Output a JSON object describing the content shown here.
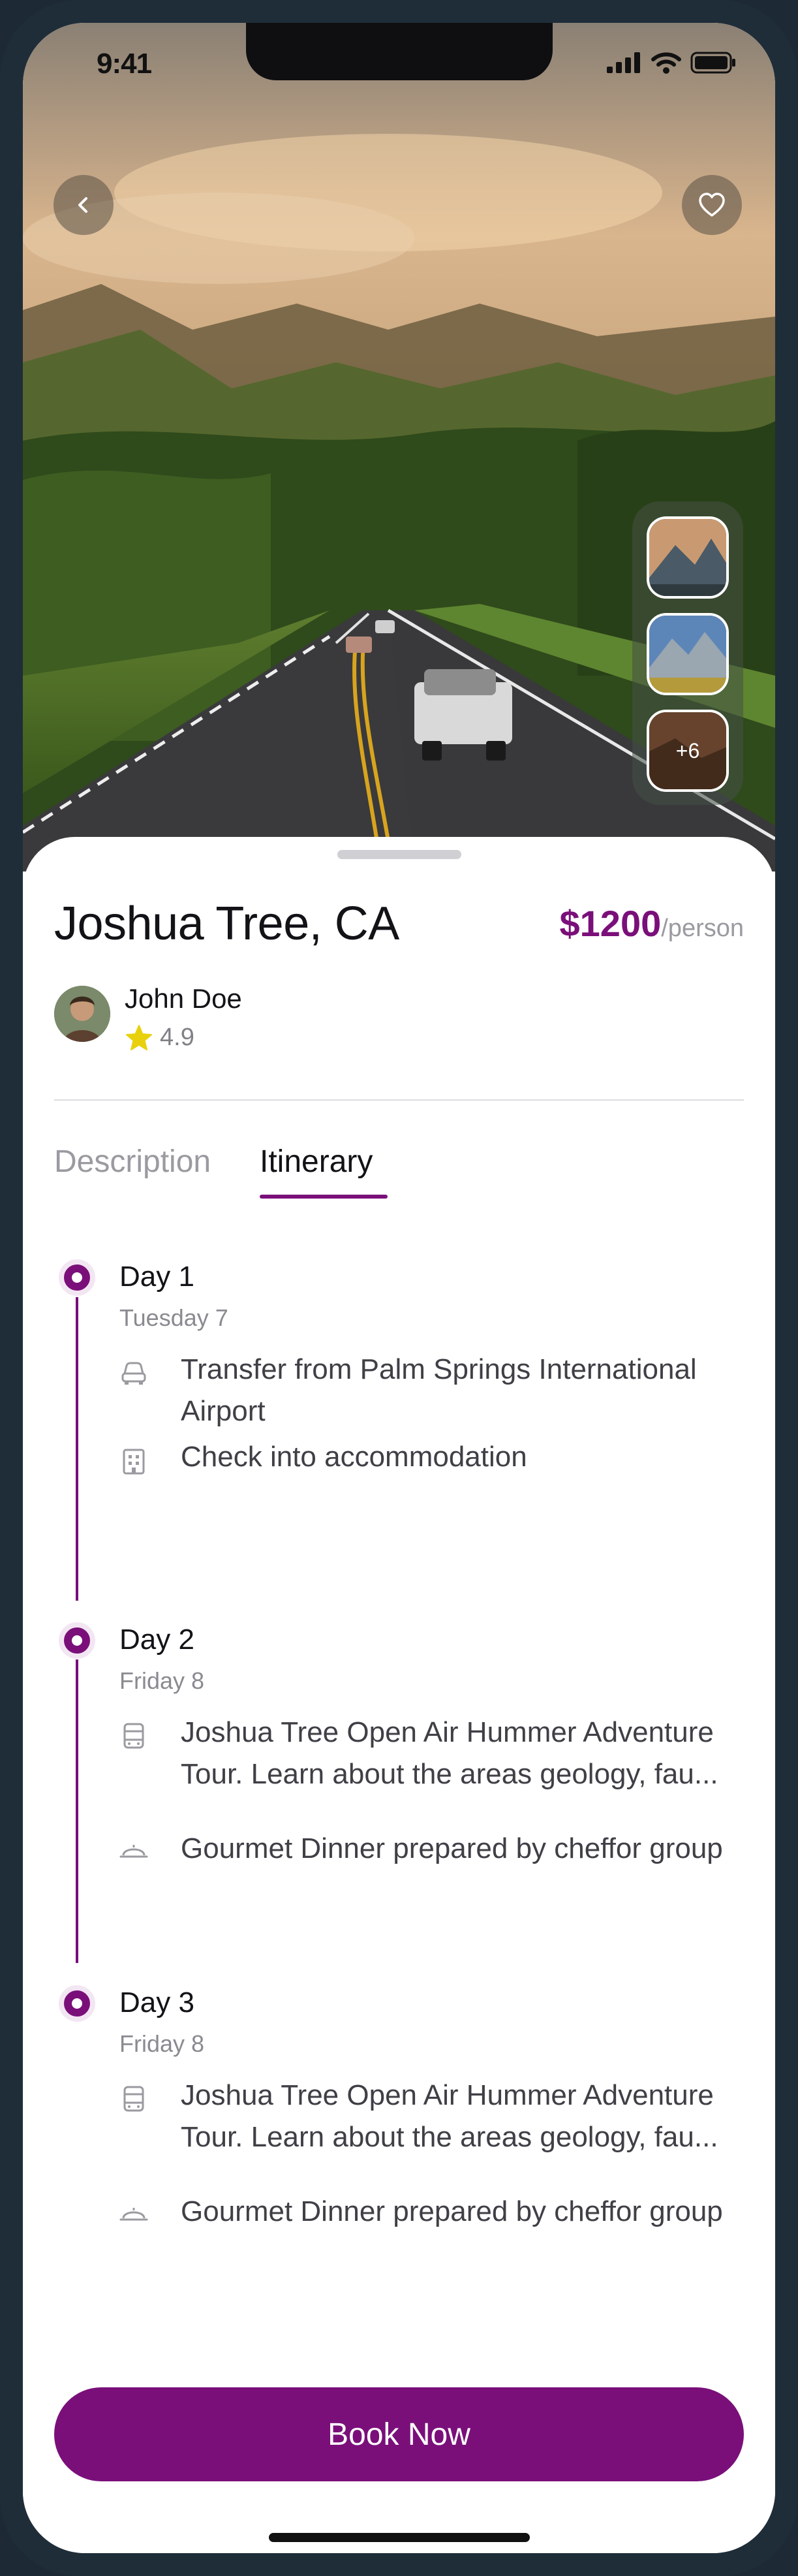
{
  "status_bar": {
    "time": "9:41"
  },
  "hero": {
    "more_photos_label": "+6"
  },
  "trip": {
    "title": "Joshua Tree, CA",
    "price": "$1200",
    "price_unit": "/person"
  },
  "host": {
    "name": "John Doe",
    "rating": "4.9"
  },
  "tabs": [
    {
      "label": "Description",
      "active": false
    },
    {
      "label": "Itinerary",
      "active": true
    }
  ],
  "itinerary": [
    {
      "day": "Day 1",
      "date": "Tuesday 7",
      "activities": [
        {
          "icon": "car-icon",
          "text": "Transfer from Palm Springs International Airport"
        },
        {
          "icon": "building-icon",
          "text": "Check into accommodation"
        }
      ]
    },
    {
      "day": "Day 2",
      "date": "Friday 8",
      "activities": [
        {
          "icon": "bus-icon",
          "text": "Joshua Tree Open Air Hummer Adventure Tour. Learn about the areas geology, fau..."
        },
        {
          "icon": "cloche-icon",
          "text": "Gourmet Dinner prepared by cheffor group"
        }
      ]
    },
    {
      "day": "Day 3",
      "date": "Friday 8",
      "activities": [
        {
          "icon": "bus-icon",
          "text": "Joshua Tree Open Air Hummer Adventure Tour. Learn about the areas geology, fau..."
        },
        {
          "icon": "cloche-icon",
          "text": "Gourmet Dinner prepared by cheffor group"
        }
      ]
    }
  ],
  "cta": {
    "book_label": "Book Now"
  },
  "colors": {
    "accent": "#7a0f7a",
    "star": "#e8d10c"
  }
}
